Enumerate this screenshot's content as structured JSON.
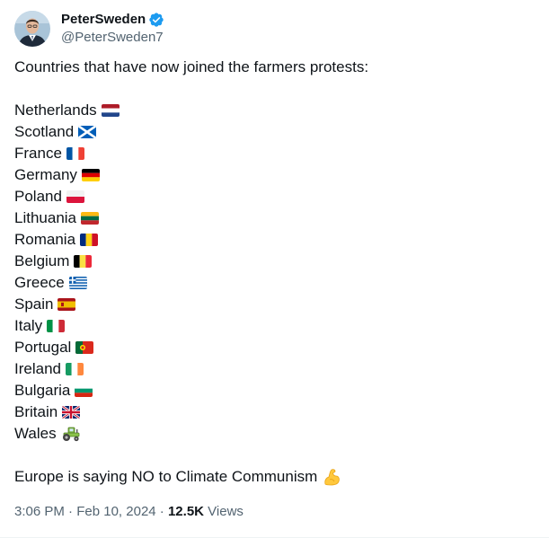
{
  "author": {
    "display_name": "PeterSweden",
    "handle": "@PeterSweden7",
    "verified_badge": "verified-badge-icon",
    "badge_color": "#1d9bf0"
  },
  "tweet": {
    "intro": "Countries that have now joined the farmers protests:",
    "countries": [
      {
        "name": "Netherlands",
        "flag": "flag-netherlands-icon"
      },
      {
        "name": "Scotland",
        "flag": "flag-scotland-icon"
      },
      {
        "name": "France",
        "flag": "flag-france-icon"
      },
      {
        "name": "Germany",
        "flag": "flag-germany-icon"
      },
      {
        "name": "Poland",
        "flag": "flag-poland-icon"
      },
      {
        "name": "Lithuania",
        "flag": "flag-lithuania-icon"
      },
      {
        "name": "Romania",
        "flag": "flag-romania-icon"
      },
      {
        "name": "Belgium",
        "flag": "flag-belgium-icon"
      },
      {
        "name": "Greece",
        "flag": "flag-greece-icon"
      },
      {
        "name": "Spain",
        "flag": "flag-spain-icon"
      },
      {
        "name": "Italy",
        "flag": "flag-italy-icon"
      },
      {
        "name": "Portugal",
        "flag": "flag-portugal-icon"
      },
      {
        "name": "Ireland",
        "flag": "flag-ireland-icon"
      },
      {
        "name": "Bulgaria",
        "flag": "flag-bulgaria-icon"
      },
      {
        "name": "Britain",
        "flag": "flag-uk-icon"
      },
      {
        "name": "Wales",
        "flag": "tractor-icon"
      }
    ],
    "closing": "Europe is saying NO to Climate Communism",
    "closing_emoji": "flexed-biceps-icon"
  },
  "meta": {
    "time": "3:06 PM",
    "separator": "·",
    "date": "Feb 10, 2024",
    "views_count": "12.5K",
    "views_label": "Views"
  }
}
